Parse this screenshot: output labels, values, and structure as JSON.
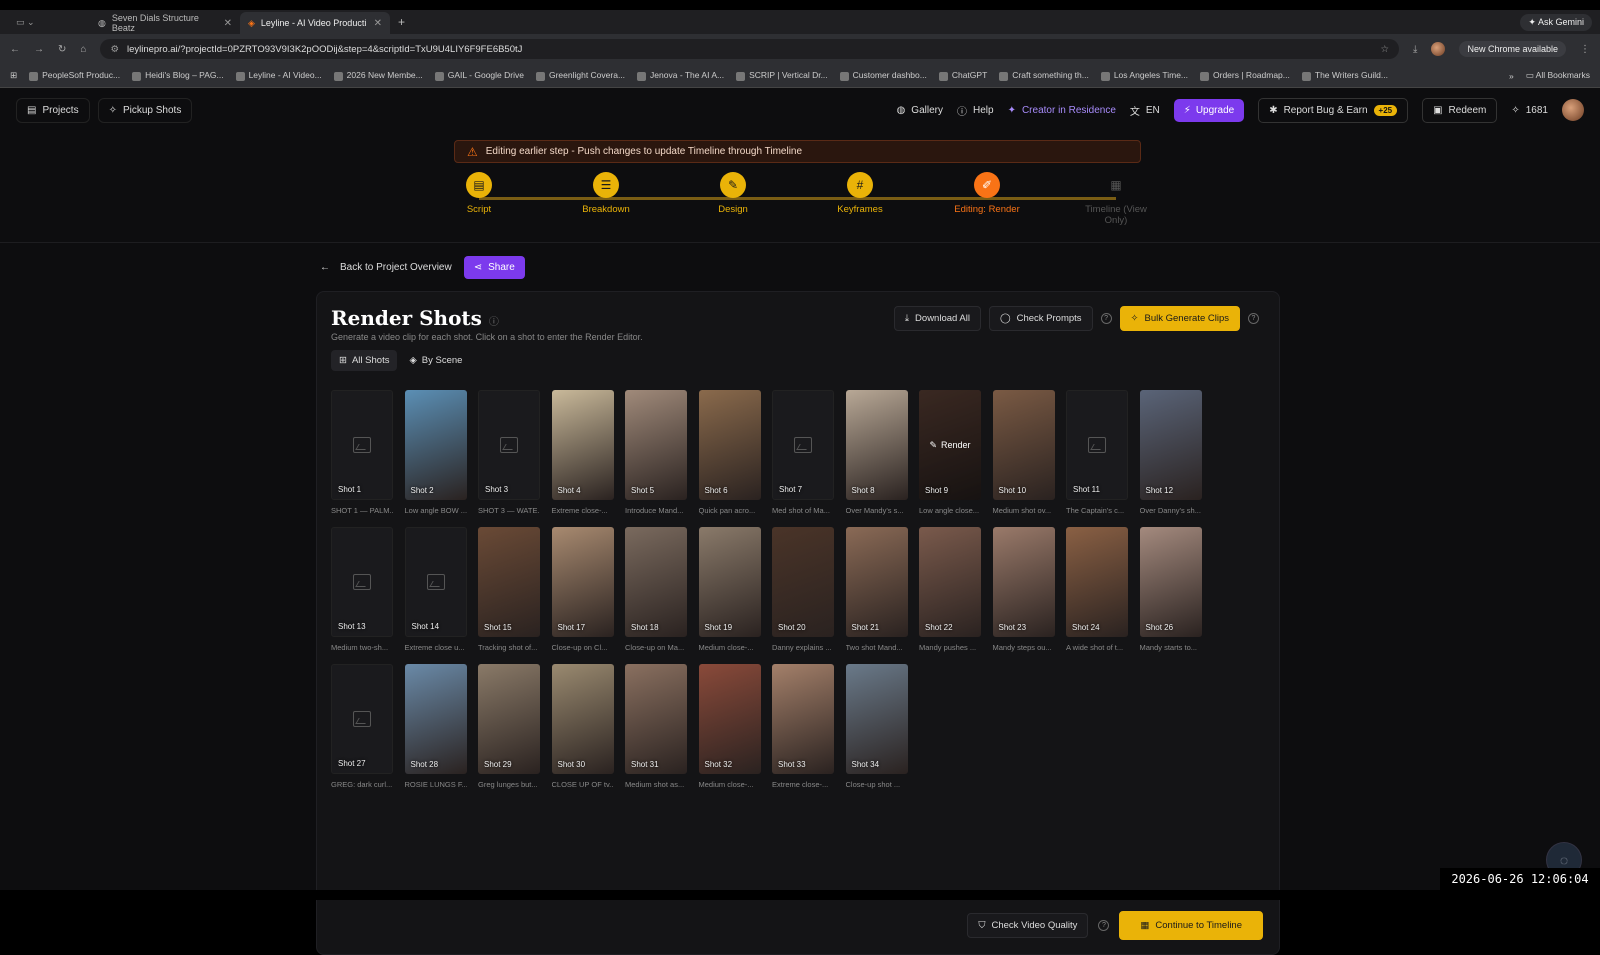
{
  "browser": {
    "tabs": [
      {
        "title": "Seven Dials Structure Beatz"
      },
      {
        "title": "Leyline - AI Video Production"
      }
    ],
    "ask_label": "Ask Gemini",
    "url": "leylinepro.ai/?projectId=0PZRTO93V9I3K2pOODij&step=4&scriptId=TxU9U4LIY6F9FE6B50tJ",
    "new_chrome_label": "New Chrome available",
    "bookmarks": [
      "PeopleSoft Produc...",
      "Heidi's Blog – PAG...",
      "Leyline - AI Video...",
      "2026 New Membe...",
      "GAIL - Google Drive",
      "Greenlight Covera...",
      "Jenova - The AI A...",
      "SCRIP | Vertical Dr...",
      "Customer dashbo...",
      "ChatGPT",
      "Craft something th...",
      "Los Angeles Time...",
      "Orders | Roadmap...",
      "The Writers Guild..."
    ],
    "all_bookmarks_label": "All Bookmarks"
  },
  "nav": {
    "projects": "Projects",
    "pickup": "Pickup Shots",
    "gallery": "Gallery",
    "help": "Help",
    "creator": "Creator in Residence",
    "lang": "EN",
    "upgrade": "Upgrade",
    "report": "Report Bug & Earn",
    "report_badge": "+25",
    "redeem": "Redeem",
    "credits": "1681"
  },
  "warning": "Editing earlier step - Push changes to update Timeline through Timeline",
  "steps": [
    {
      "label": "Script"
    },
    {
      "label": "Breakdown"
    },
    {
      "label": "Design"
    },
    {
      "label": "Keyframes"
    },
    {
      "label": "Editing: Render"
    },
    {
      "label": "Timeline (View Only)"
    }
  ],
  "back_label": "Back to Project Overview",
  "share_label": "Share",
  "panel": {
    "title": "Render Shots",
    "subtitle": "Generate a video clip for each shot. Click on a shot to enter the Render Editor.",
    "tab_all": "All Shots",
    "tab_scene": "By Scene",
    "download_all": "Download All",
    "check_prompts": "Check Prompts",
    "bulk_generate": "Bulk Generate Clips",
    "render_hover": "Render",
    "check_quality": "Check Video Quality",
    "continue": "Continue to Timeline"
  },
  "shots": [
    {
      "label": "Shot 1",
      "caption": "SHOT 1 — PALM...",
      "image": false,
      "color": ""
    },
    {
      "label": "Shot 2",
      "caption": "Low angle BOW ...",
      "image": true,
      "color": "#5b8fb5"
    },
    {
      "label": "Shot 3",
      "caption": "SHOT 3 — WATE...",
      "image": false,
      "color": ""
    },
    {
      "label": "Shot 4",
      "caption": "Extreme close-...",
      "image": true,
      "color": "#c9b99a"
    },
    {
      "label": "Shot 5",
      "caption": "Introduce Mand...",
      "image": true,
      "color": "#a08a7a"
    },
    {
      "label": "Shot 6",
      "caption": "Quick pan acro...",
      "image": true,
      "color": "#8a6a4c"
    },
    {
      "label": "Shot 7",
      "caption": "Med shot of Ma...",
      "image": false,
      "color": ""
    },
    {
      "label": "Shot 8",
      "caption": "Over Mandy's s...",
      "image": true,
      "color": "#b8a896"
    },
    {
      "label": "Shot 9",
      "caption": "Low angle close...",
      "image": true,
      "color": "#6a4a3e",
      "hover": true
    },
    {
      "label": "Shot 10",
      "caption": "Medium shot ov...",
      "image": true,
      "color": "#7a5a44"
    },
    {
      "label": "Shot 11",
      "caption": "The Captain's c...",
      "image": false,
      "color": ""
    },
    {
      "label": "Shot 12",
      "caption": "Over Danny's sh...",
      "image": true,
      "color": "#5a6478"
    },
    {
      "label": "Shot 13",
      "caption": "Medium two-sh...",
      "image": false,
      "color": ""
    },
    {
      "label": "Shot 14",
      "caption": "Extreme close u...",
      "image": false,
      "color": ""
    },
    {
      "label": "Shot 15",
      "caption": "Tracking shot of...",
      "image": true,
      "color": "#6a4a36"
    },
    {
      "label": "Shot 17",
      "caption": "Close-up on Cl...",
      "image": true,
      "color": "#a88a70"
    },
    {
      "label": "Shot 18",
      "caption": "Close-up on Ma...",
      "image": true,
      "color": "#7a6a5e"
    },
    {
      "label": "Shot 19",
      "caption": "Medium close-...",
      "image": true,
      "color": "#8a7a6a"
    },
    {
      "label": "Shot 20",
      "caption": "Danny explains ...",
      "image": true,
      "color": "#4a3428"
    },
    {
      "label": "Shot 21",
      "caption": "Two shot Mand...",
      "image": true,
      "color": "#8a6a56"
    },
    {
      "label": "Shot 22",
      "caption": "Mandy pushes ...",
      "image": true,
      "color": "#7a5a4c"
    },
    {
      "label": "Shot 23",
      "caption": "Mandy steps ou...",
      "image": true,
      "color": "#9a7a6a"
    },
    {
      "label": "Shot 24",
      "caption": "A wide shot of t...",
      "image": true,
      "color": "#8a6044"
    },
    {
      "label": "Shot 26",
      "caption": "Mandy starts to...",
      "image": true,
      "color": "#a48a7e"
    },
    {
      "label": "Shot 27",
      "caption": "GREG: dark curl...",
      "image": false,
      "color": ""
    },
    {
      "label": "Shot 28",
      "caption": "ROSIE LUNGS F...",
      "image": true,
      "color": "#6a8aa8"
    },
    {
      "label": "Shot 29",
      "caption": "Greg lunges but...",
      "image": true,
      "color": "#8a7a68"
    },
    {
      "label": "Shot 30",
      "caption": "CLOSE UP OF tv...",
      "image": true,
      "color": "#9a8a70"
    },
    {
      "label": "Shot 31",
      "caption": "Medium shot as...",
      "image": true,
      "color": "#8a7060"
    },
    {
      "label": "Shot 32",
      "caption": "Medium close-...",
      "image": true,
      "color": "#8a4a3a"
    },
    {
      "label": "Shot 33",
      "caption": "Extreme close-...",
      "image": true,
      "color": "#a4806a"
    },
    {
      "label": "Shot 34",
      "caption": "Close-up shot ...",
      "image": true,
      "color": "#6a7a8a"
    }
  ],
  "timestamp": "2026-06-26 12:06:04"
}
